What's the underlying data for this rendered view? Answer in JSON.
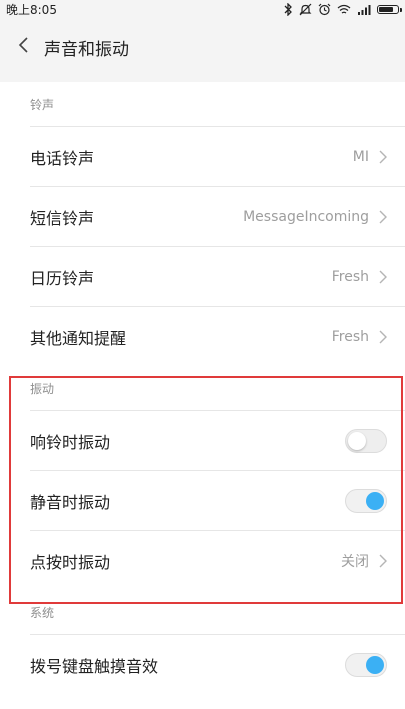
{
  "status_bar": {
    "time": "晚上8:05",
    "icons": [
      "bluetooth-icon",
      "mute-icon",
      "alarm-icon",
      "wifi-icon",
      "signal-icon",
      "battery-icon"
    ]
  },
  "header": {
    "title": "声音和振动",
    "back_icon": "chevron-left-icon"
  },
  "sections": {
    "ringtone": {
      "header": "铃声",
      "items": [
        {
          "label": "电话铃声",
          "value": "MI"
        },
        {
          "label": "短信铃声",
          "value": "MessageIncoming"
        },
        {
          "label": "日历铃声",
          "value": "Fresh"
        },
        {
          "label": "其他通知提醒",
          "value": "Fresh"
        }
      ]
    },
    "vibration": {
      "header": "振动",
      "items": [
        {
          "label": "响铃时振动",
          "state": "off"
        },
        {
          "label": "静音时振动",
          "state": "on"
        },
        {
          "label": "点按时振动",
          "value": "关闭"
        }
      ]
    },
    "system": {
      "header": "系统",
      "items": [
        {
          "label": "拨号键盘触摸音效",
          "state": "on"
        }
      ]
    }
  },
  "colors": {
    "accent": "#3bb0f4",
    "highlight": "#e03a3a",
    "background": "#f4f4f4",
    "card": "#ffffff"
  }
}
